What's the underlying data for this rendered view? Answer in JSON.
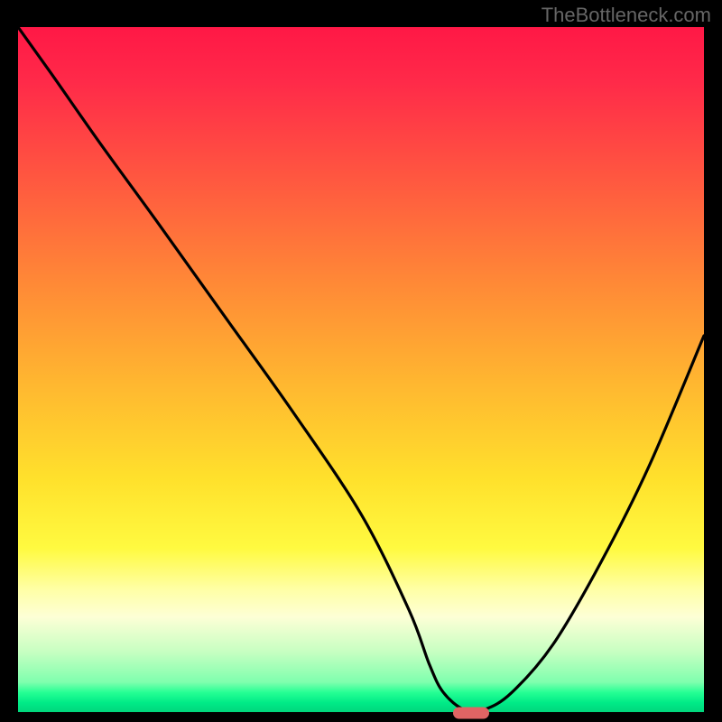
{
  "watermark": "TheBottleneck.com",
  "chart_data": {
    "type": "line",
    "title": "",
    "xlabel": "",
    "ylabel": "",
    "xlim": [
      0,
      100
    ],
    "ylim": [
      0,
      100
    ],
    "grid": false,
    "legend": false,
    "series": [
      {
        "name": "bottleneck-curve",
        "x": [
          0,
          5,
          12,
          20,
          30,
          40,
          50,
          57,
          60,
          62,
          65,
          68,
          72,
          78,
          85,
          92,
          100
        ],
        "values": [
          100,
          93,
          83,
          72,
          58,
          44,
          29,
          15,
          7,
          3,
          0.5,
          0.5,
          3,
          10,
          22,
          36,
          55
        ]
      }
    ],
    "marker": {
      "x": 66,
      "y": 0,
      "color": "#e06464",
      "shape": "pill"
    },
    "background_gradient_meaning": "red=high bottleneck, green=low bottleneck",
    "gradient_stops": [
      {
        "pos": 0,
        "color": "#ff1846"
      },
      {
        "pos": 8,
        "color": "#ff2a49"
      },
      {
        "pos": 22,
        "color": "#ff5740"
      },
      {
        "pos": 38,
        "color": "#ff8b36"
      },
      {
        "pos": 52,
        "color": "#ffb730"
      },
      {
        "pos": 66,
        "color": "#ffe12c"
      },
      {
        "pos": 76,
        "color": "#fffa40"
      },
      {
        "pos": 82,
        "color": "#ffffa6"
      },
      {
        "pos": 86,
        "color": "#fdffd6"
      },
      {
        "pos": 91,
        "color": "#c8ffc2"
      },
      {
        "pos": 95.5,
        "color": "#7fffae"
      },
      {
        "pos": 97,
        "color": "#26ff94"
      },
      {
        "pos": 98.5,
        "color": "#00eb87"
      },
      {
        "pos": 100,
        "color": "#00d47c"
      }
    ]
  }
}
